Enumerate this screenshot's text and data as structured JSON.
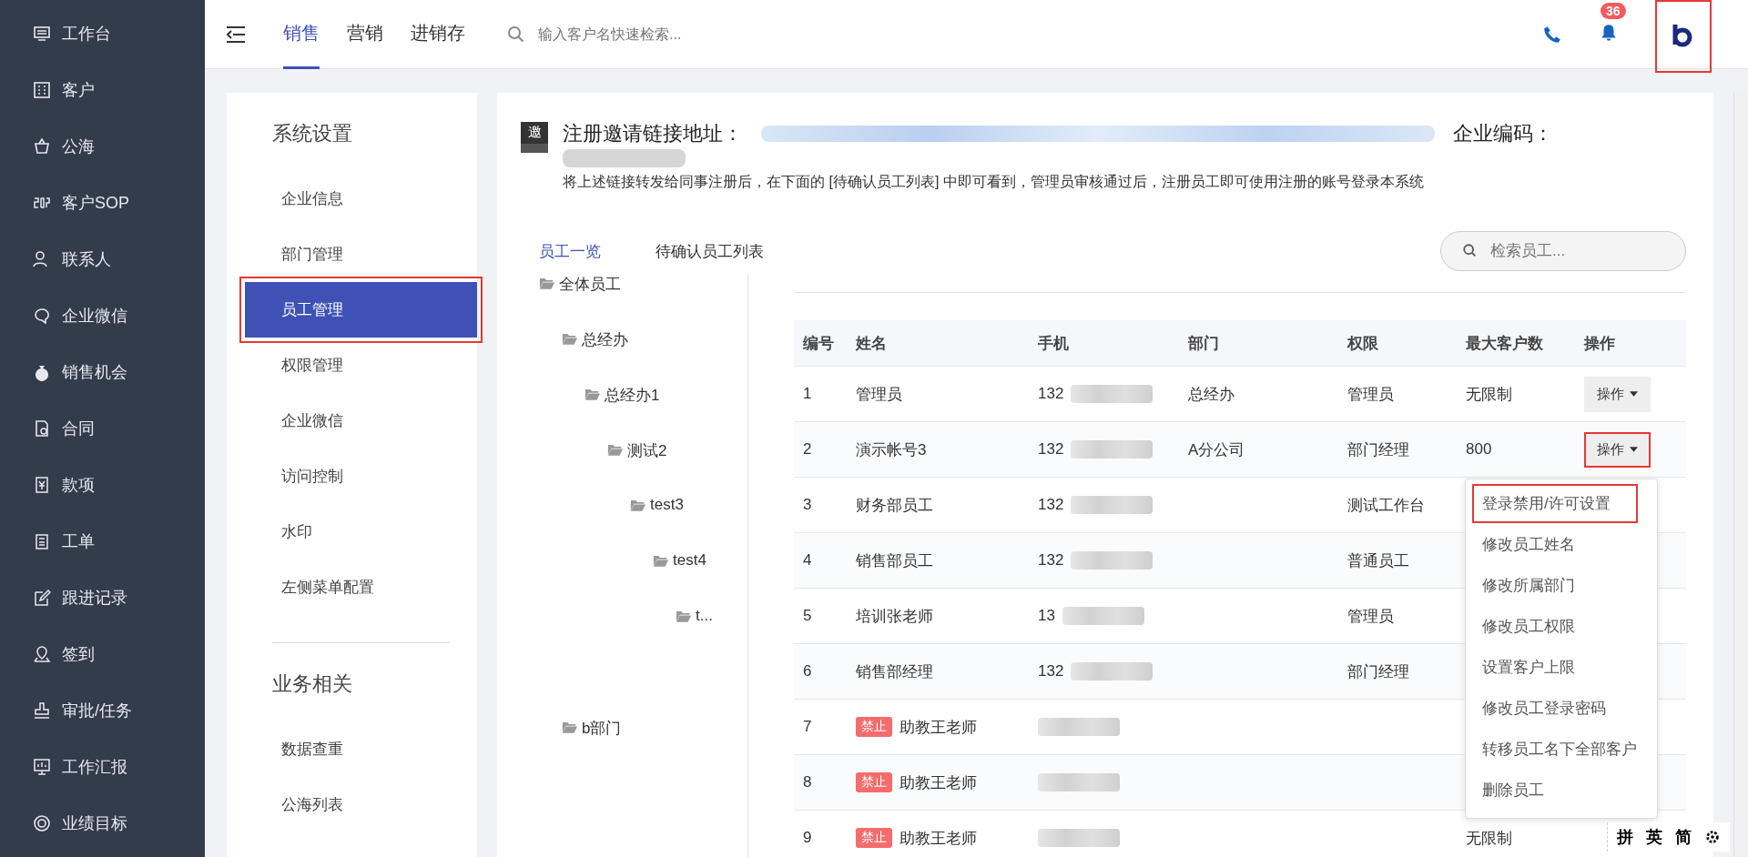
{
  "sidebar": {
    "items": [
      {
        "label": "工作台"
      },
      {
        "label": "客户"
      },
      {
        "label": "公海"
      },
      {
        "label": "客户SOP"
      },
      {
        "label": "联系人"
      },
      {
        "label": "企业微信"
      },
      {
        "label": "销售机会"
      },
      {
        "label": "合同"
      },
      {
        "label": "款项"
      },
      {
        "label": "工单"
      },
      {
        "label": "跟进记录"
      },
      {
        "label": "签到"
      },
      {
        "label": "审批/任务"
      },
      {
        "label": "工作汇报"
      },
      {
        "label": "业绩目标"
      }
    ]
  },
  "topbar": {
    "tabs": [
      {
        "label": "销售",
        "selected": true
      },
      {
        "label": "营销",
        "selected": false
      },
      {
        "label": "进销存",
        "selected": false
      }
    ],
    "search": {
      "placeholder": "输入客户名快速检索..."
    },
    "notifications": "36",
    "logo_highlighted": true
  },
  "settings_menu": {
    "sections": [
      {
        "title": "系统设置",
        "items": [
          {
            "label": "企业信息",
            "selected": false,
            "highlighted": false
          },
          {
            "label": "部门管理",
            "selected": false,
            "highlighted": false
          },
          {
            "label": "员工管理",
            "selected": true,
            "highlighted": true
          },
          {
            "label": "权限管理",
            "selected": false,
            "highlighted": false
          },
          {
            "label": "企业微信",
            "selected": false,
            "highlighted": false
          },
          {
            "label": "访问控制",
            "selected": false,
            "highlighted": false
          },
          {
            "label": "水印",
            "selected": false,
            "highlighted": false
          },
          {
            "label": "左侧菜单配置",
            "selected": false,
            "highlighted": false
          }
        ]
      },
      {
        "title": "业务相关",
        "items": [
          {
            "label": "数据查重",
            "selected": false,
            "highlighted": false
          },
          {
            "label": "公海列表",
            "selected": false,
            "highlighted": false
          }
        ]
      }
    ]
  },
  "invite": {
    "icon_text": "邀",
    "title": "注册邀请链接地址：",
    "code_label": "企业编码：",
    "description": "将上述链接转发给同事注册后，在下面的 [待确认员工列表] 中即可看到，管理员审核通过后，注册员工即可使用注册的账号登录本系统"
  },
  "employee_tabs": [
    {
      "label": "员工一览",
      "selected": true
    },
    {
      "label": "待确认员工列表",
      "selected": false
    }
  ],
  "employee_search": {
    "placeholder": "检索员工..."
  },
  "tree": {
    "label": "全体员工",
    "children": [
      {
        "label": "总经办",
        "children": [
          {
            "label": "总经办1",
            "children": [
              {
                "label": "测试2",
                "children": [
                  {
                    "label": "test3",
                    "children": [
                      {
                        "label": "test4",
                        "children": [
                          {
                            "label": "t..."
                          }
                        ]
                      }
                    ]
                  }
                ]
              }
            ]
          }
        ]
      },
      {
        "label": "b部门"
      }
    ]
  },
  "table": {
    "columns": [
      "编号",
      "姓名",
      "手机",
      "部门",
      "权限",
      "最大客户数",
      "操作"
    ],
    "rows": [
      {
        "no": "1",
        "name": "管理员",
        "phone": "132",
        "department": "总经办",
        "role": "管理员",
        "max_customers": "无限制",
        "action": "操作"
      },
      {
        "no": "2",
        "name": "演示帐号3",
        "phone": "132",
        "department": "A分公司",
        "role": "部门经理",
        "max_customers": "800",
        "action": "操作",
        "action_highlighted": true
      },
      {
        "no": "3",
        "name": "财务部员工",
        "phone": "132",
        "role": "测试工作台"
      },
      {
        "no": "4",
        "name": "销售部员工",
        "phone": "132",
        "role": "普通员工"
      },
      {
        "no": "5",
        "name": "培训张老师",
        "phone": "13",
        "role": "管理员"
      },
      {
        "no": "6",
        "name": "销售部经理",
        "phone": "132",
        "role": "部门经理"
      },
      {
        "no": "7",
        "badge": "禁止",
        "name": "助教王老师"
      },
      {
        "no": "8",
        "badge": "禁止",
        "name": "助教王老师"
      },
      {
        "no": "9",
        "badge": "禁止",
        "name": "助教王老师",
        "max_customers": "无限制"
      }
    ]
  },
  "action_menu": {
    "items": [
      {
        "label": "登录禁用/许可设置",
        "highlighted": true
      },
      {
        "label": "修改员工姓名",
        "highlighted": false
      },
      {
        "label": "修改所属部门",
        "highlighted": false
      },
      {
        "label": "修改员工权限",
        "highlighted": false
      },
      {
        "label": "设置客户上限",
        "highlighted": false
      },
      {
        "label": "修改员工登录密码",
        "highlighted": false
      },
      {
        "label": "转移员工名下全部客户",
        "highlighted": false
      },
      {
        "label": "删除员工",
        "highlighted": false
      }
    ]
  },
  "ime_toolbar": {
    "items": [
      "拼",
      "英",
      "简"
    ]
  }
}
